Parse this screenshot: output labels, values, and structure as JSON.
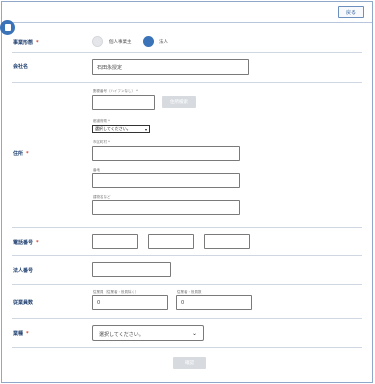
{
  "header": {
    "back_label": "戻る"
  },
  "business_type": {
    "label": "事業形態",
    "required_mark": "*",
    "options": [
      {
        "label": "個人事業主",
        "selected": false
      },
      {
        "label": "法人",
        "selected": true
      }
    ]
  },
  "company_name": {
    "label": "会社名",
    "value": "石田永授定"
  },
  "address": {
    "label": "住所",
    "required_mark": "*",
    "postal_label": "郵便番号（ハイフンなし） *",
    "search_button": "住所検索",
    "prefecture_label": "都道府県 *",
    "prefecture_value": "選択してください。",
    "city_label": "市区町村 *",
    "street_label": "番地",
    "building_label": "建物名など"
  },
  "phone": {
    "label": "電話番号",
    "required_mark": "*"
  },
  "corporate_number": {
    "label": "法人番号"
  },
  "employees": {
    "label": "従業員数",
    "full_label": "従業員（従業者・役員除く）",
    "full_value": "0",
    "other_label": "従業者・役員数",
    "other_value": "0"
  },
  "industry": {
    "label": "業種",
    "required_mark": "*",
    "value": "選択してください。"
  },
  "footer": {
    "confirm_label": "確認"
  },
  "colors": {
    "accent": "#3a73b8",
    "required": "#d0452f",
    "label": "#1e3f6f",
    "divider": "#cfd7e3"
  },
  "icons": {
    "corner": "document-icon",
    "select": "chevron-down-icon"
  }
}
